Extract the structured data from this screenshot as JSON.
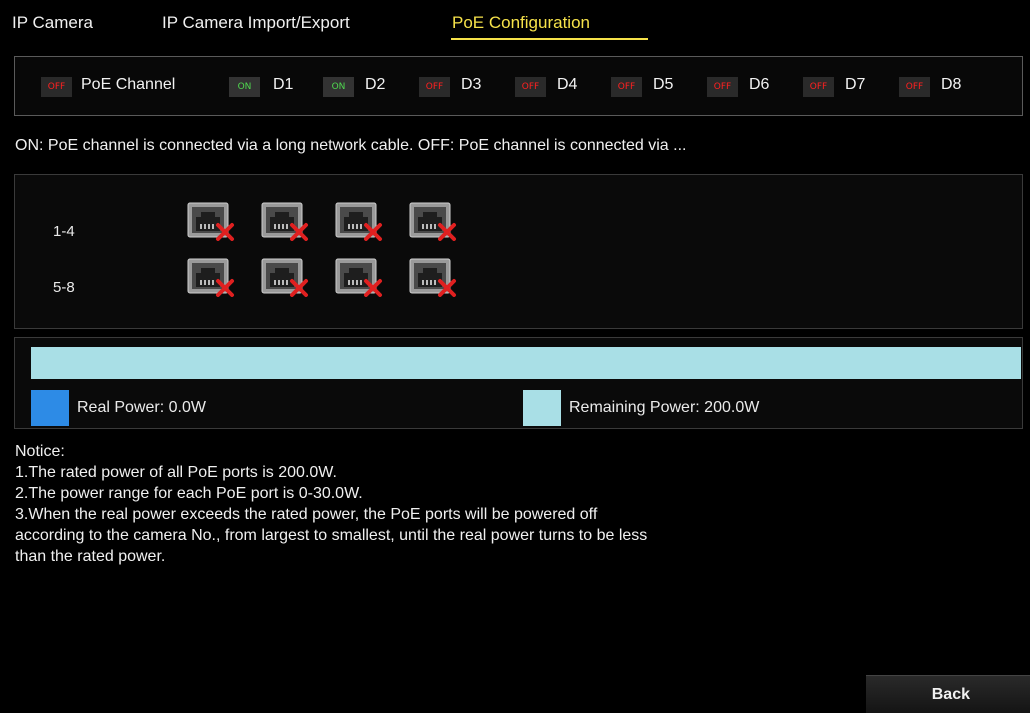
{
  "tabs": [
    {
      "label": "IP Camera"
    },
    {
      "label": "IP Camera Import/Export"
    },
    {
      "label": "PoE Configuration"
    }
  ],
  "channels": {
    "poe_toggle": "OFF",
    "poe_label": "PoE Channel",
    "items": [
      {
        "state": "ON",
        "label": "D1"
      },
      {
        "state": "ON",
        "label": "D2"
      },
      {
        "state": "OFF",
        "label": "D3"
      },
      {
        "state": "OFF",
        "label": "D4"
      },
      {
        "state": "OFF",
        "label": "D5"
      },
      {
        "state": "OFF",
        "label": "D6"
      },
      {
        "state": "OFF",
        "label": "D7"
      },
      {
        "state": "OFF",
        "label": "D8"
      }
    ]
  },
  "info_text": "ON: PoE channel is connected via a long network cable. OFF: PoE channel is connected via ...",
  "ports": {
    "rows": [
      {
        "label": "1-4"
      },
      {
        "label": "5-8"
      }
    ],
    "status": "disconnected"
  },
  "power": {
    "real_fraction": 0.0,
    "real_color": "#2d8be6",
    "remaining_color": "#a9dfe6",
    "real_label": "Real Power: 0.0W",
    "remaining_label": "Remaining Power: 200.0W"
  },
  "notice": {
    "title": "Notice:",
    "lines": [
      "1.The rated power of all PoE ports is 200.0W.",
      "2.The power range for each PoE port is 0-30.0W.",
      "3.When the real power exceeds the rated power, the PoE ports will be powered off",
      "according to the camera No., from largest to smallest, until the real power turns to be less",
      "than the rated power."
    ]
  },
  "back_label": "Back"
}
